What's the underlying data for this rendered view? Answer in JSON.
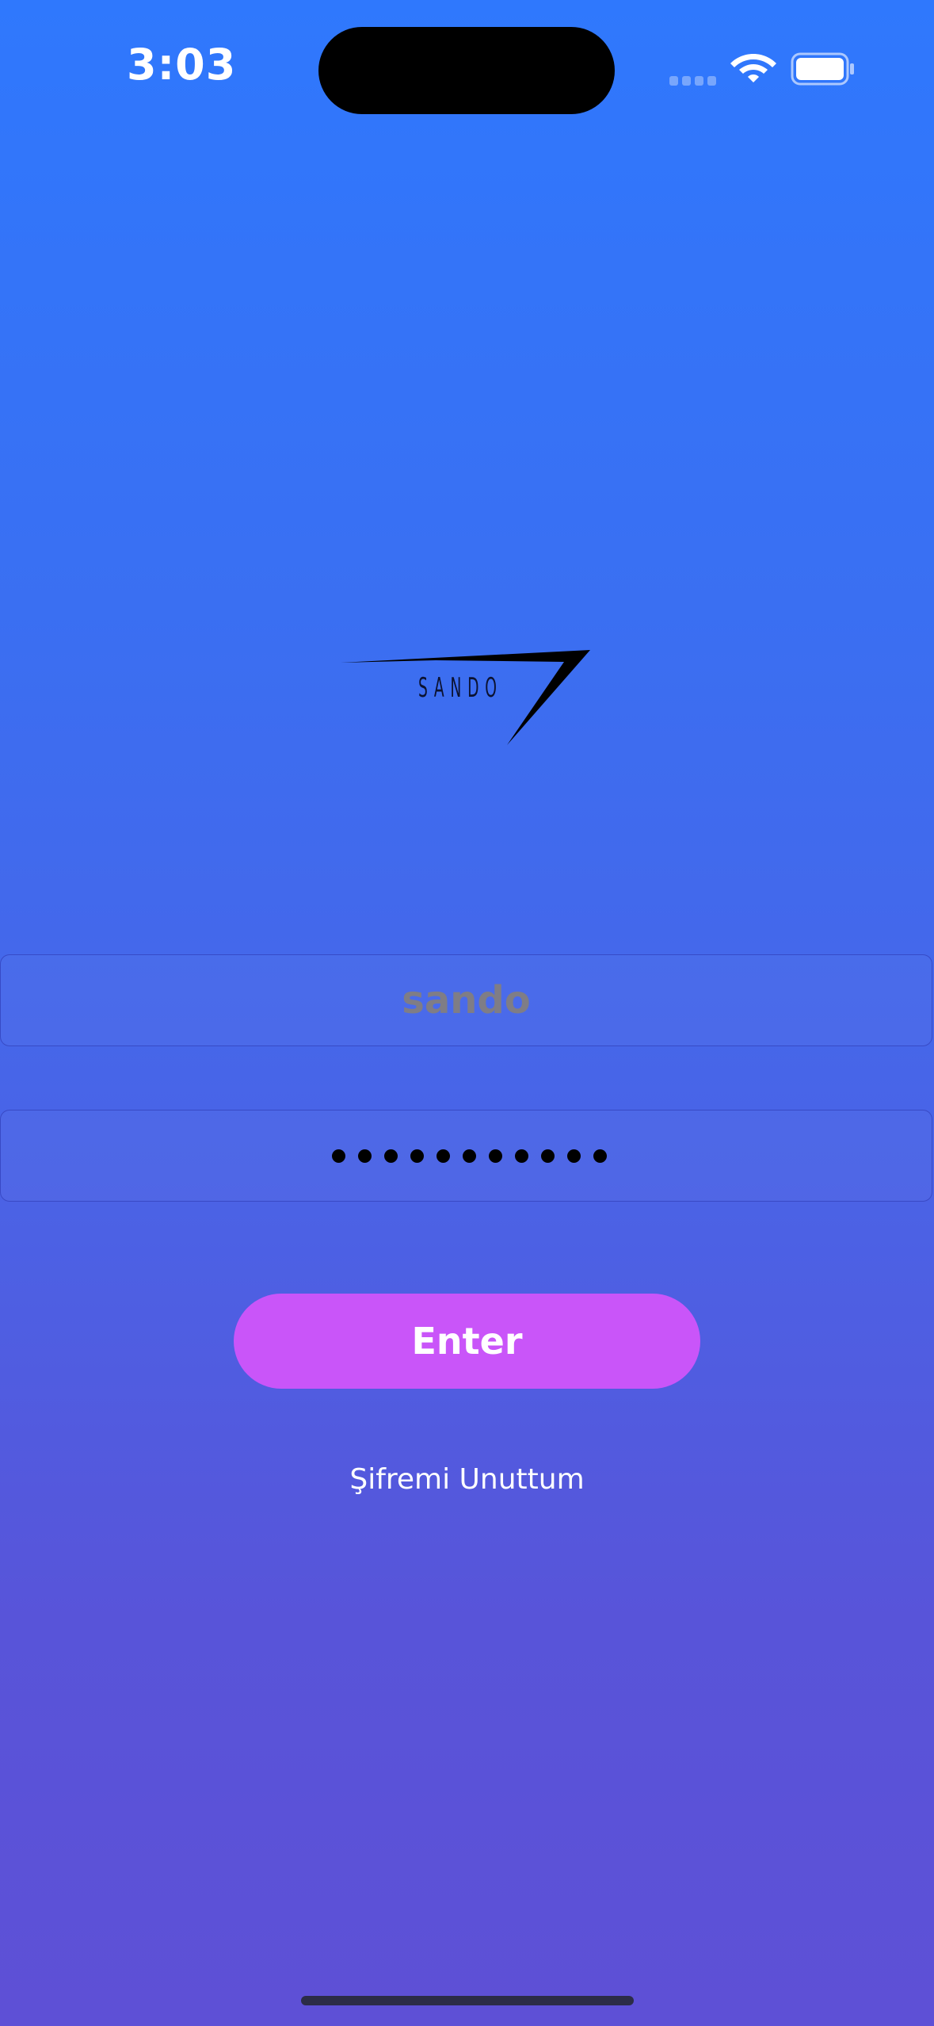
{
  "status_bar": {
    "time": "3:03",
    "icons": [
      "cellular-signal-icon",
      "wifi-icon",
      "battery-icon"
    ]
  },
  "logo": {
    "wordmark": "SANDO",
    "icon": "sando-logo-icon"
  },
  "login_form": {
    "username_value": "sando",
    "password_masked": "●●●●●●●●●●●",
    "password_length": 11,
    "enter_label": "Enter",
    "forgot_password_label": "Şifremi Unuttum"
  },
  "colors": {
    "gradient_top": "#2f78fd",
    "gradient_bottom": "#5e50d6",
    "button": "#c955f9",
    "username_text": "#7f7d86"
  }
}
